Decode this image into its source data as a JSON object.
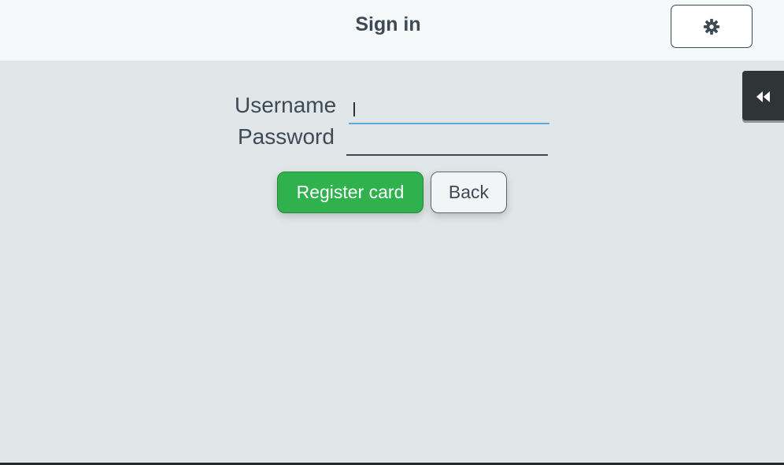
{
  "header": {
    "title": "Sign in",
    "settings_icon": "gear-icon"
  },
  "side_panel": {
    "toggle_icon": "double-chevron-left-icon"
  },
  "form": {
    "username_label": "Username",
    "username_value": "",
    "password_label": "Password",
    "password_value": ""
  },
  "actions": {
    "register_label": "Register card",
    "back_label": "Back"
  },
  "colors": {
    "background": "#e1e7e8",
    "header_background": "#f6f9f9",
    "text": "#3d4a55",
    "primary_button": "#2fb24d",
    "focus_underline": "#5fa8d9",
    "side_toggle": "#2f3436"
  }
}
